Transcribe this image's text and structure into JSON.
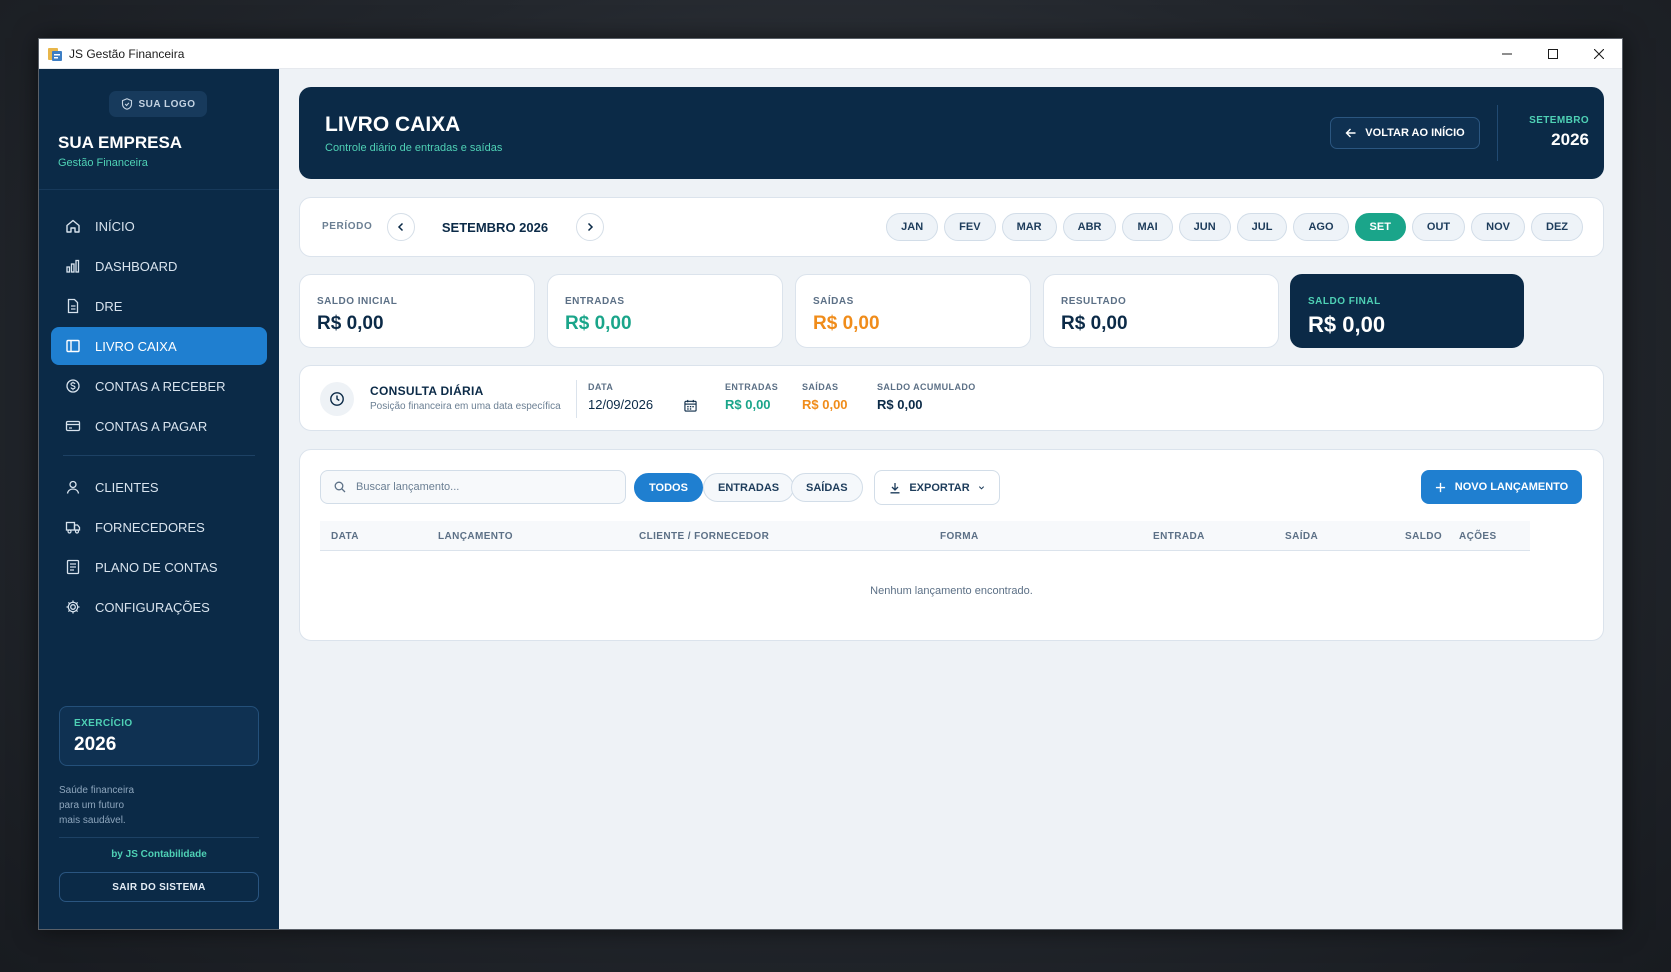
{
  "window": {
    "title": "JS Gestão Financeira"
  },
  "sidebar": {
    "logo_label": "SUA LOGO",
    "company": "SUA EMPRESA",
    "company_sub": "Gestão Financeira",
    "items": [
      {
        "label": "INÍCIO",
        "icon": "home-icon"
      },
      {
        "label": "DASHBOARD",
        "icon": "bar-chart-icon"
      },
      {
        "label": "DRE",
        "icon": "document-icon"
      },
      {
        "label": "LIVRO CAIXA",
        "icon": "book-icon",
        "active": true
      },
      {
        "label": "CONTAS A RECEBER",
        "icon": "coin-icon"
      },
      {
        "label": "CONTAS A PAGAR",
        "icon": "credit-card-icon"
      },
      {
        "label": "CLIENTES",
        "icon": "user-icon"
      },
      {
        "label": "FORNECEDORES",
        "icon": "truck-icon"
      },
      {
        "label": "PLANO DE CONTAS",
        "icon": "list-icon"
      },
      {
        "label": "CONFIGURAÇÕES",
        "icon": "gear-icon"
      }
    ],
    "exercicio_label": "EXERCÍCIO",
    "exercicio_value": "2026",
    "tagline_1": "Saúde financeira",
    "tagline_2": "para um futuro",
    "tagline_3": "mais saudável.",
    "byline": "by JS Contabilidade",
    "logout": "SAIR DO SISTEMA"
  },
  "header": {
    "title": "LIVRO CAIXA",
    "subtitle": "Controle diário de entradas e saídas",
    "back_button": "VOLTAR AO INÍCIO",
    "month": "SETEMBRO",
    "year": "2026"
  },
  "period": {
    "label": "PERÍODO",
    "value": "SETEMBRO 2026",
    "months": [
      "JAN",
      "FEV",
      "MAR",
      "ABR",
      "MAI",
      "JUN",
      "JUL",
      "AGO",
      "SET",
      "OUT",
      "NOV",
      "DEZ"
    ],
    "active_month": "SET"
  },
  "stats": [
    {
      "label": "SALDO INICIAL",
      "value": "R$ 0,00",
      "color": "#0b2a47"
    },
    {
      "label": "ENTRADAS",
      "value": "R$ 0,00",
      "color": "#1aa58a"
    },
    {
      "label": "SAÍDAS",
      "value": "R$ 0,00",
      "color": "#f08c1a"
    },
    {
      "label": "RESULTADO",
      "value": "R$ 0,00",
      "color": "#0b2a47"
    },
    {
      "label": "SALDO FINAL",
      "value": "R$ 0,00",
      "color": "#ffffff"
    }
  ],
  "daily": {
    "title": "CONSULTA DIÁRIA",
    "subtitle": "Posição financeira em uma data específica",
    "date_label": "DATA",
    "date_value": "12/09/2026",
    "in_label": "ENTRADAS",
    "in_value": "R$ 0,00",
    "out_label": "SAÍDAS",
    "out_value": "R$ 0,00",
    "acc_label": "SALDO ACUMULADO",
    "acc_value": "R$ 0,00"
  },
  "table": {
    "search_placeholder": "Buscar lançamento...",
    "filters": [
      "TODOS",
      "ENTRADAS",
      "SAÍDAS"
    ],
    "export_label": "EXPORTAR",
    "new_label": "NOVO LANÇAMENTO",
    "columns": [
      "DATA",
      "LANÇAMENTO",
      "CLIENTE / FORNECEDOR",
      "FORMA",
      "ENTRADA",
      "SAÍDA",
      "SALDO",
      "AÇÕES"
    ],
    "empty_message": "Nenhum lançamento encontrado."
  },
  "colors": {
    "navy": "#0b2a47",
    "blue": "#1f7fd0",
    "teal": "#1aa58a",
    "orange": "#f08c1a"
  }
}
